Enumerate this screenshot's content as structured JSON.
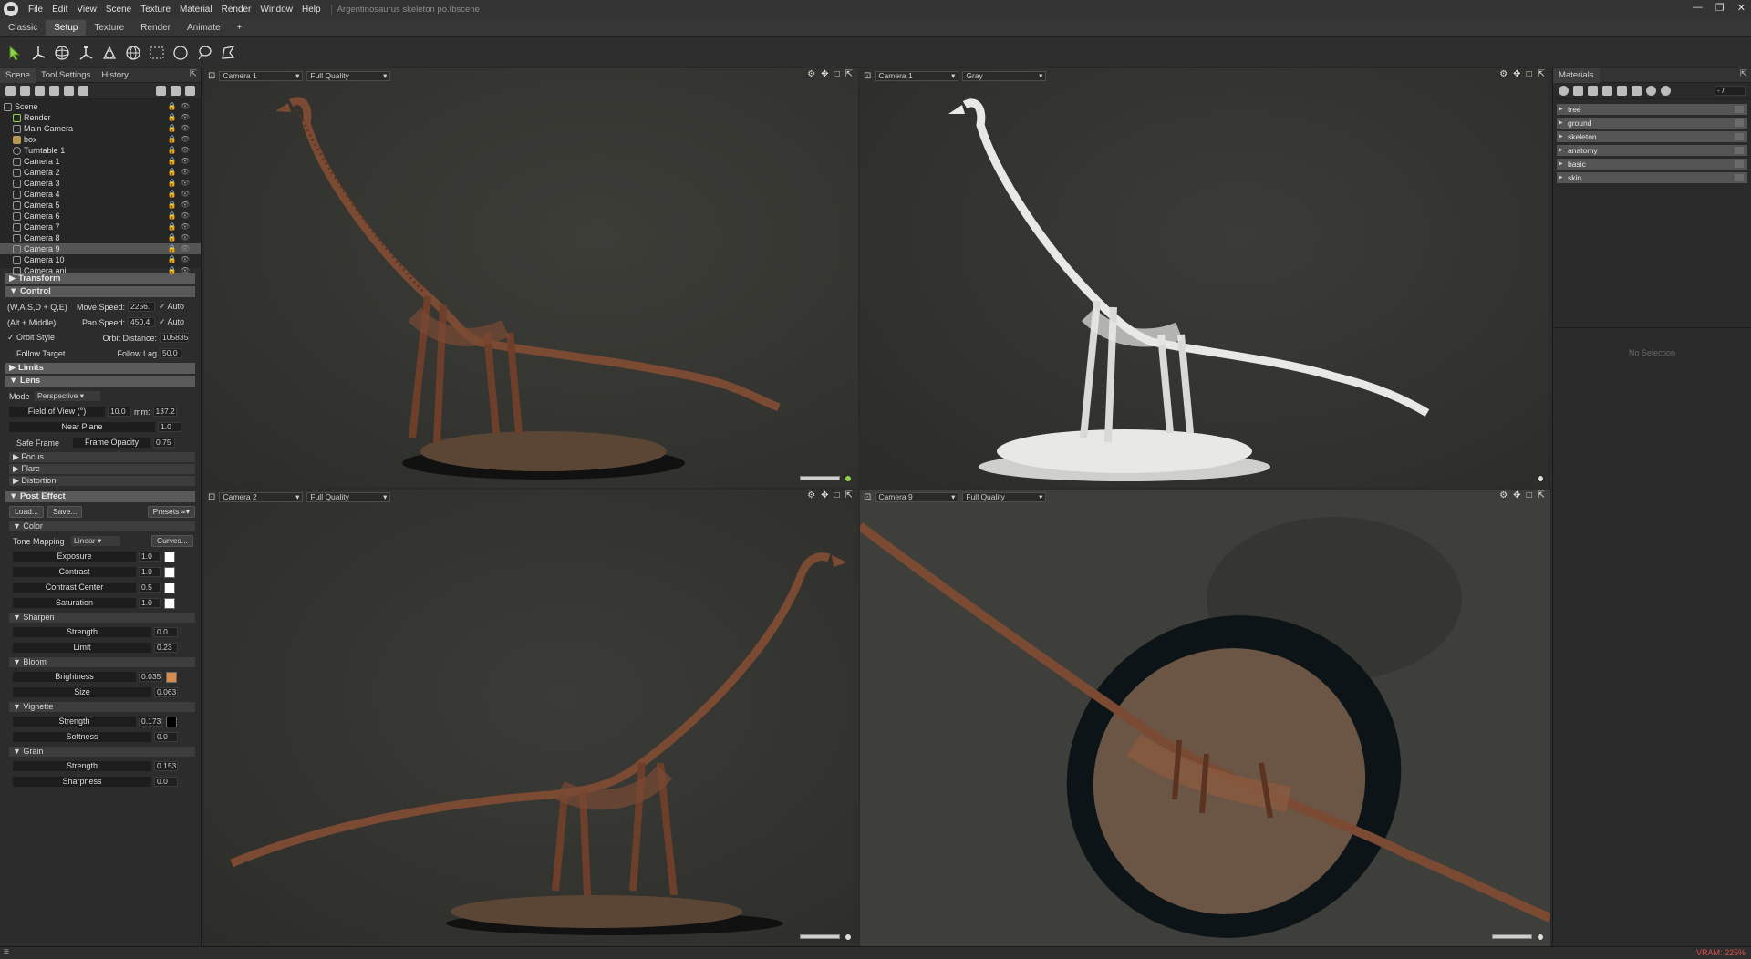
{
  "menubar": {
    "items": [
      "File",
      "Edit",
      "View",
      "Scene",
      "Texture",
      "Material",
      "Render",
      "Window",
      "Help"
    ],
    "doc_title": "Argentinosaurus skeleton po.tbscene"
  },
  "workspace_tabs": [
    "Classic",
    "Setup",
    "Texture",
    "Render",
    "Animate",
    "+"
  ],
  "scene_panel": {
    "tabs": [
      "Scene",
      "Tool Settings",
      "History"
    ],
    "tree": [
      {
        "label": "Scene"
      },
      {
        "label": "Render"
      },
      {
        "label": "Main Camera"
      },
      {
        "label": "box"
      },
      {
        "label": "Turntable 1"
      },
      {
        "label": "Camera 1"
      },
      {
        "label": "Camera 2"
      },
      {
        "label": "Camera 3"
      },
      {
        "label": "Camera 4"
      },
      {
        "label": "Camera 5"
      },
      {
        "label": "Camera 6"
      },
      {
        "label": "Camera 7"
      },
      {
        "label": "Camera 8"
      },
      {
        "label": "Camera 9"
      },
      {
        "label": "Camera 10"
      },
      {
        "label": "Camera ani"
      }
    ]
  },
  "props": {
    "transform": "Transform",
    "control": "Control",
    "keys_label": "(W,A,S,D + Q,E)",
    "move_speed_label": "Move Speed:",
    "move_speed": "2256.",
    "auto1": "Auto",
    "alt_label": "(Alt + Middle)",
    "pan_speed_label": "Pan Speed:",
    "pan_speed": "450.4",
    "auto2": "Auto",
    "orbit_style": "Orbit Style",
    "orbit_distance_label": "Orbit Distance:",
    "orbit_distance": "105835",
    "follow_target": "Follow Target",
    "follow_lag_label": "Follow Lag",
    "follow_lag": "50.0",
    "limits": "Limits",
    "lens": "Lens",
    "mode_label": "Mode",
    "mode_value": "Perspective",
    "fov_label": "Field of View (°)",
    "fov": "10.0",
    "mm_label": "mm:",
    "mm": "137.2",
    "near_plane_label": "Near Plane",
    "near_plane": "1.0",
    "safe_frame": "Safe Frame",
    "frame_opacity_label": "Frame Opacity",
    "frame_opacity": "0.75",
    "focus": "Focus",
    "flare": "Flare",
    "distortion": "Distortion",
    "post_effect": "Post Effect",
    "load": "Load...",
    "save": "Save...",
    "presets": "Presets",
    "color": "Color",
    "tone_mapping_label": "Tone Mapping",
    "tone_mapping": "Linear",
    "curves": "Curves...",
    "exposure_label": "Exposure",
    "exposure": "1.0",
    "contrast_label": "Contrast",
    "contrast": "1.0",
    "contrast_center_label": "Contrast Center",
    "contrast_center": "0.5",
    "saturation_label": "Saturation",
    "saturation": "1.0",
    "sharpen": "Sharpen",
    "sharpen_strength_label": "Strength",
    "sharpen_strength": "0.0",
    "limit_label": "Limit",
    "limit": "0.23",
    "bloom": "Bloom",
    "brightness_label": "Brightness",
    "brightness": "0.035",
    "size_label": "Size",
    "size": "0.063",
    "vignette": "Vignette",
    "vig_strength_label": "Strength",
    "vig_strength": "0.173",
    "softness_label": "Softness",
    "softness": "0.0",
    "grain": "Grain",
    "grain_strength_label": "Strength",
    "grain_strength": "0.153",
    "sharpness_label": "Sharpness",
    "sharpness": "0.0"
  },
  "viewports": [
    {
      "camera": "Camera 1",
      "quality": "Full Quality"
    },
    {
      "camera": "Camera 1",
      "quality": "Gray"
    },
    {
      "camera": "Camera 2",
      "quality": "Full Quality"
    },
    {
      "camera": "Camera 9",
      "quality": "Full Quality"
    }
  ],
  "materials": {
    "title": "Materials",
    "search": "- /",
    "items": [
      "tree",
      "ground",
      "skeleton",
      "anatomy",
      "basic",
      "skin"
    ],
    "no_selection": "No Selection"
  },
  "status": {
    "vram": "VRAM: 225%"
  },
  "colors": {
    "bloom_swatch": "#d88a48",
    "bone": "#7b4a33",
    "gray_bone": "#e8e8e4"
  }
}
